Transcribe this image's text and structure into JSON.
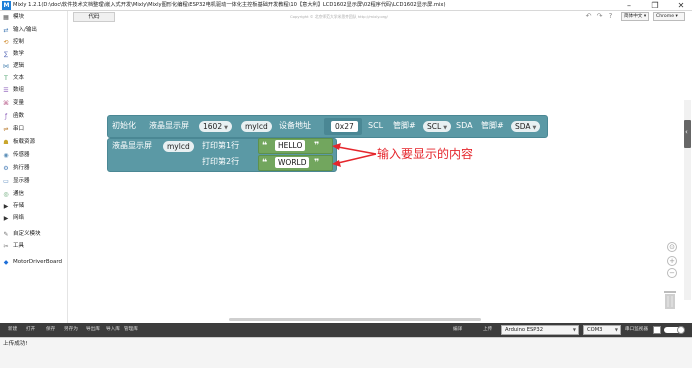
{
  "window": {
    "app_icon": "M",
    "title": "Mixly 1.2.1(D:\\doc\\软件技术文档整理\\嵌入式开发\\Mixly\\Mixly图形化编程\\ESP32电机驱动一体化主控板基础开发教程\\10【意大利】LCD1602显示屏\\02程序代码\\LCD1602显示屏.mix)",
    "minimize": "–",
    "maximize": "❐",
    "close": "✕"
  },
  "toolbar": {
    "tab_label": "代码",
    "copyright": "Copyright © 北京师范大学米思齐团队 http://mixly.org/",
    "language": "简体中文",
    "browser": "Chrome"
  },
  "sidebar": {
    "items": [
      {
        "label": "模块",
        "icon": "modules-icon",
        "glyph": "▦",
        "color": "#555555"
      },
      {
        "label": "输入/输出",
        "icon": "io-icon",
        "glyph": "⇄",
        "color": "#4a7fb8"
      },
      {
        "label": "控制",
        "icon": "control-icon",
        "glyph": "⟲",
        "color": "#d08a2c"
      },
      {
        "label": "数学",
        "icon": "math-icon",
        "glyph": "∑",
        "color": "#5b6db8"
      },
      {
        "label": "逻辑",
        "icon": "logic-icon",
        "glyph": "⋈",
        "color": "#5b8fb8"
      },
      {
        "label": "文本",
        "icon": "text-icon",
        "glyph": "T",
        "color": "#4aa06b"
      },
      {
        "label": "数组",
        "icon": "array-icon",
        "glyph": "☰",
        "color": "#8a5bb8"
      },
      {
        "label": "变量",
        "icon": "variable-icon",
        "glyph": "⌘",
        "color": "#b85b8a"
      },
      {
        "label": "函数",
        "icon": "function-icon",
        "glyph": "ƒ",
        "color": "#8a5bb8"
      },
      {
        "label": "串口",
        "icon": "serial-icon",
        "glyph": "⇌",
        "color": "#b87a2c"
      },
      {
        "label": "板载资源",
        "icon": "board-icon",
        "glyph": "☗",
        "color": "#c9a62c"
      },
      {
        "label": "传感器",
        "icon": "sensor-icon",
        "glyph": "◉",
        "color": "#5b8fb8"
      },
      {
        "label": "执行器",
        "icon": "actuator-icon",
        "glyph": "⚙",
        "color": "#4a7fb8"
      },
      {
        "label": "显示器",
        "icon": "display-icon",
        "glyph": "▭",
        "color": "#4a7fb8"
      },
      {
        "label": "通信",
        "icon": "comm-icon",
        "glyph": "◎",
        "color": "#5ba06b"
      },
      {
        "label": "存储",
        "icon": "storage-icon",
        "glyph": "▶",
        "color": "#333333"
      },
      {
        "label": "网络",
        "icon": "network-icon",
        "glyph": "▶",
        "color": "#333333"
      },
      {
        "label": "自定义模块",
        "icon": "custom-module-icon",
        "glyph": "✎",
        "color": "#6b6b6b"
      },
      {
        "label": "工具",
        "icon": "tools-icon",
        "glyph": "✂",
        "color": "#6b6b6b"
      },
      {
        "label": "MotorDriverBoard",
        "icon": "motor-driver-icon",
        "glyph": "◆",
        "color": "#1e6fd8"
      }
    ]
  },
  "blocks": {
    "init": {
      "label_init": "初始化",
      "label_lcd": "液晶显示屏",
      "model": "1602",
      "var": "mylcd",
      "label_addr": "设备地址",
      "addr": "0x27",
      "label_scl": "SCL",
      "label_pin1": "管脚#",
      "scl_pin": "SCL",
      "label_sda": "SDA",
      "label_pin2": "管脚#",
      "sda_pin": "SDA"
    },
    "print": {
      "label_lcd": "液晶显示屏",
      "var": "mylcd",
      "line1_label": "打印第1行",
      "line1_value": "HELLO",
      "line2_label": "打印第2行",
      "line2_value": "WORLD"
    },
    "quote_open": "❝",
    "quote_close": "❞"
  },
  "annotation": "输入要显示的内容",
  "colors": {
    "lcd_block": "#5b99a5",
    "string_block": "#72a65e",
    "annotation": "#e5262c"
  },
  "bottombar": {
    "buttons": [
      "新建",
      "打开",
      "保存",
      "另存为",
      "导出库",
      "导入库",
      "管理库"
    ],
    "compile": "编译",
    "upload": "上传",
    "board": "Arduino ESP32",
    "port": "COM3",
    "serial_monitor": "串口监视器"
  },
  "output": {
    "message": "上传成功!"
  }
}
